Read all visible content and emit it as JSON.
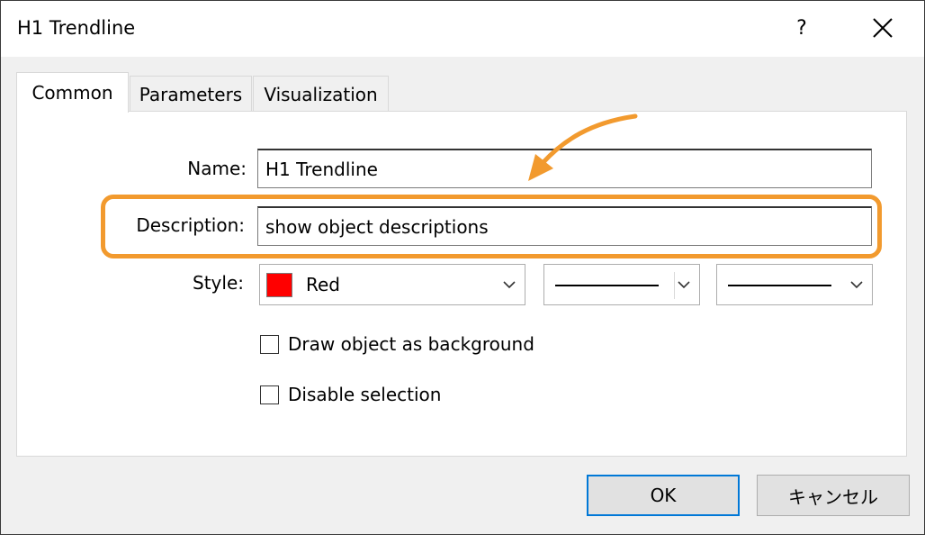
{
  "dialog": {
    "title": "H1 Trendline",
    "help_label": "?",
    "close_icon": "close-icon"
  },
  "tabs": [
    {
      "label": "Common",
      "active": true
    },
    {
      "label": "Parameters",
      "active": false
    },
    {
      "label": "Visualization",
      "active": false
    }
  ],
  "form": {
    "name_label": "Name:",
    "name_value": "H1 Trendline",
    "description_label": "Description:",
    "description_value": "show object descriptions",
    "style_label": "Style:",
    "color_name": "Red",
    "color_hex": "#ff0000",
    "line_style": "solid",
    "line_width": "thin"
  },
  "checkboxes": {
    "draw_background_label": "Draw object as background",
    "draw_background_checked": false,
    "disable_selection_label": "Disable selection",
    "disable_selection_checked": false
  },
  "buttons": {
    "ok": "OK",
    "cancel": "キャンセル"
  },
  "annotation": {
    "highlight_color": "#f29a2e"
  }
}
